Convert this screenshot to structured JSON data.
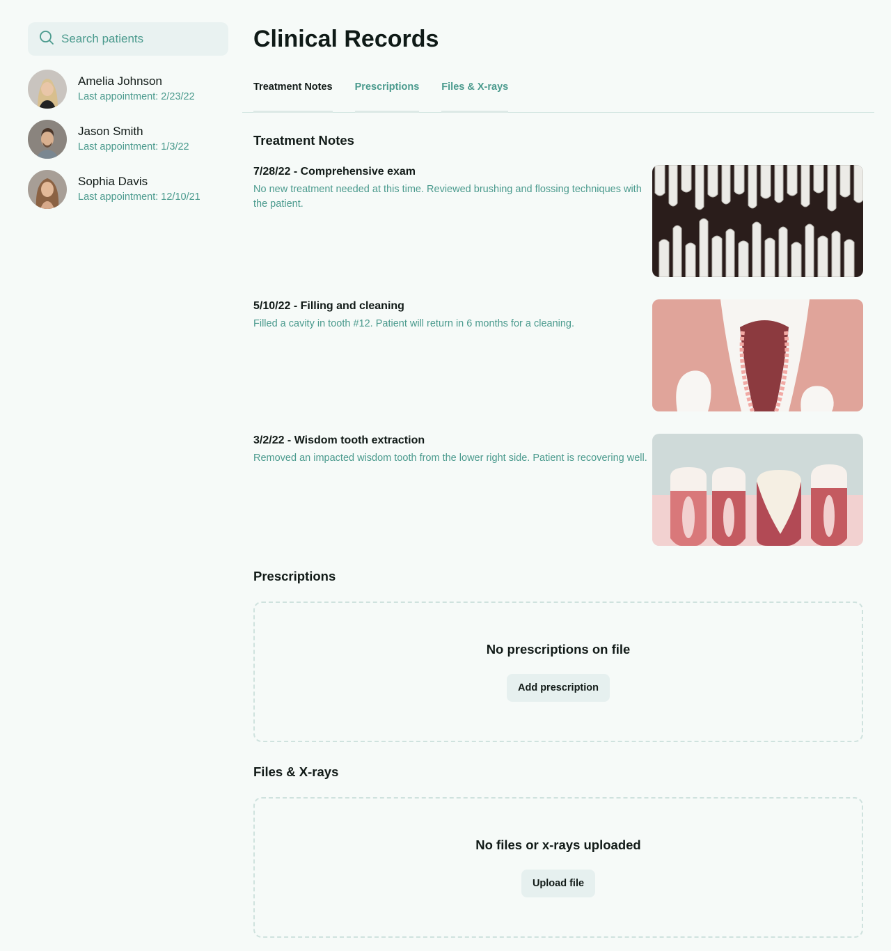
{
  "search": {
    "placeholder": "Search patients"
  },
  "patients": [
    {
      "name": "Amelia Johnson",
      "last": "Last appointment: 2/23/22"
    },
    {
      "name": "Jason Smith",
      "last": "Last appointment: 1/3/22"
    },
    {
      "name": "Sophia Davis",
      "last": "Last appointment: 12/10/21"
    }
  ],
  "page": {
    "title": "Clinical Records"
  },
  "tabs": [
    {
      "label": "Treatment Notes",
      "active": true
    },
    {
      "label": "Prescriptions",
      "active": false
    },
    {
      "label": "Files & X-rays",
      "active": false
    }
  ],
  "treatment_notes": {
    "title": "Treatment Notes",
    "items": [
      {
        "heading": "7/28/22 - Comprehensive exam",
        "text": "No new treatment needed at this time. Reviewed brushing and flossing techniques with the patient.",
        "image": "teeth-pattern-image"
      },
      {
        "heading": "5/10/22 - Filling and cleaning",
        "text": "Filled a cavity in tooth #12. Patient will return in 6 months for a cleaning.",
        "image": "tooth-cavity-image"
      },
      {
        "heading": "3/2/22 - Wisdom tooth extraction",
        "text": "Removed an impacted wisdom tooth from the lower right side. Patient is recovering well.",
        "image": "teeth-gums-image"
      }
    ]
  },
  "prescriptions": {
    "title": "Prescriptions",
    "empty_text": "No prescriptions on file",
    "button_label": "Add prescription"
  },
  "files": {
    "title": "Files & X-rays",
    "empty_text": "No files or x-rays uploaded",
    "button_label": "Upload file"
  },
  "colors": {
    "background": "#f6faf8",
    "accent": "#4a9a8d",
    "search_bg": "#e9f2f1",
    "text": "#111a17"
  }
}
